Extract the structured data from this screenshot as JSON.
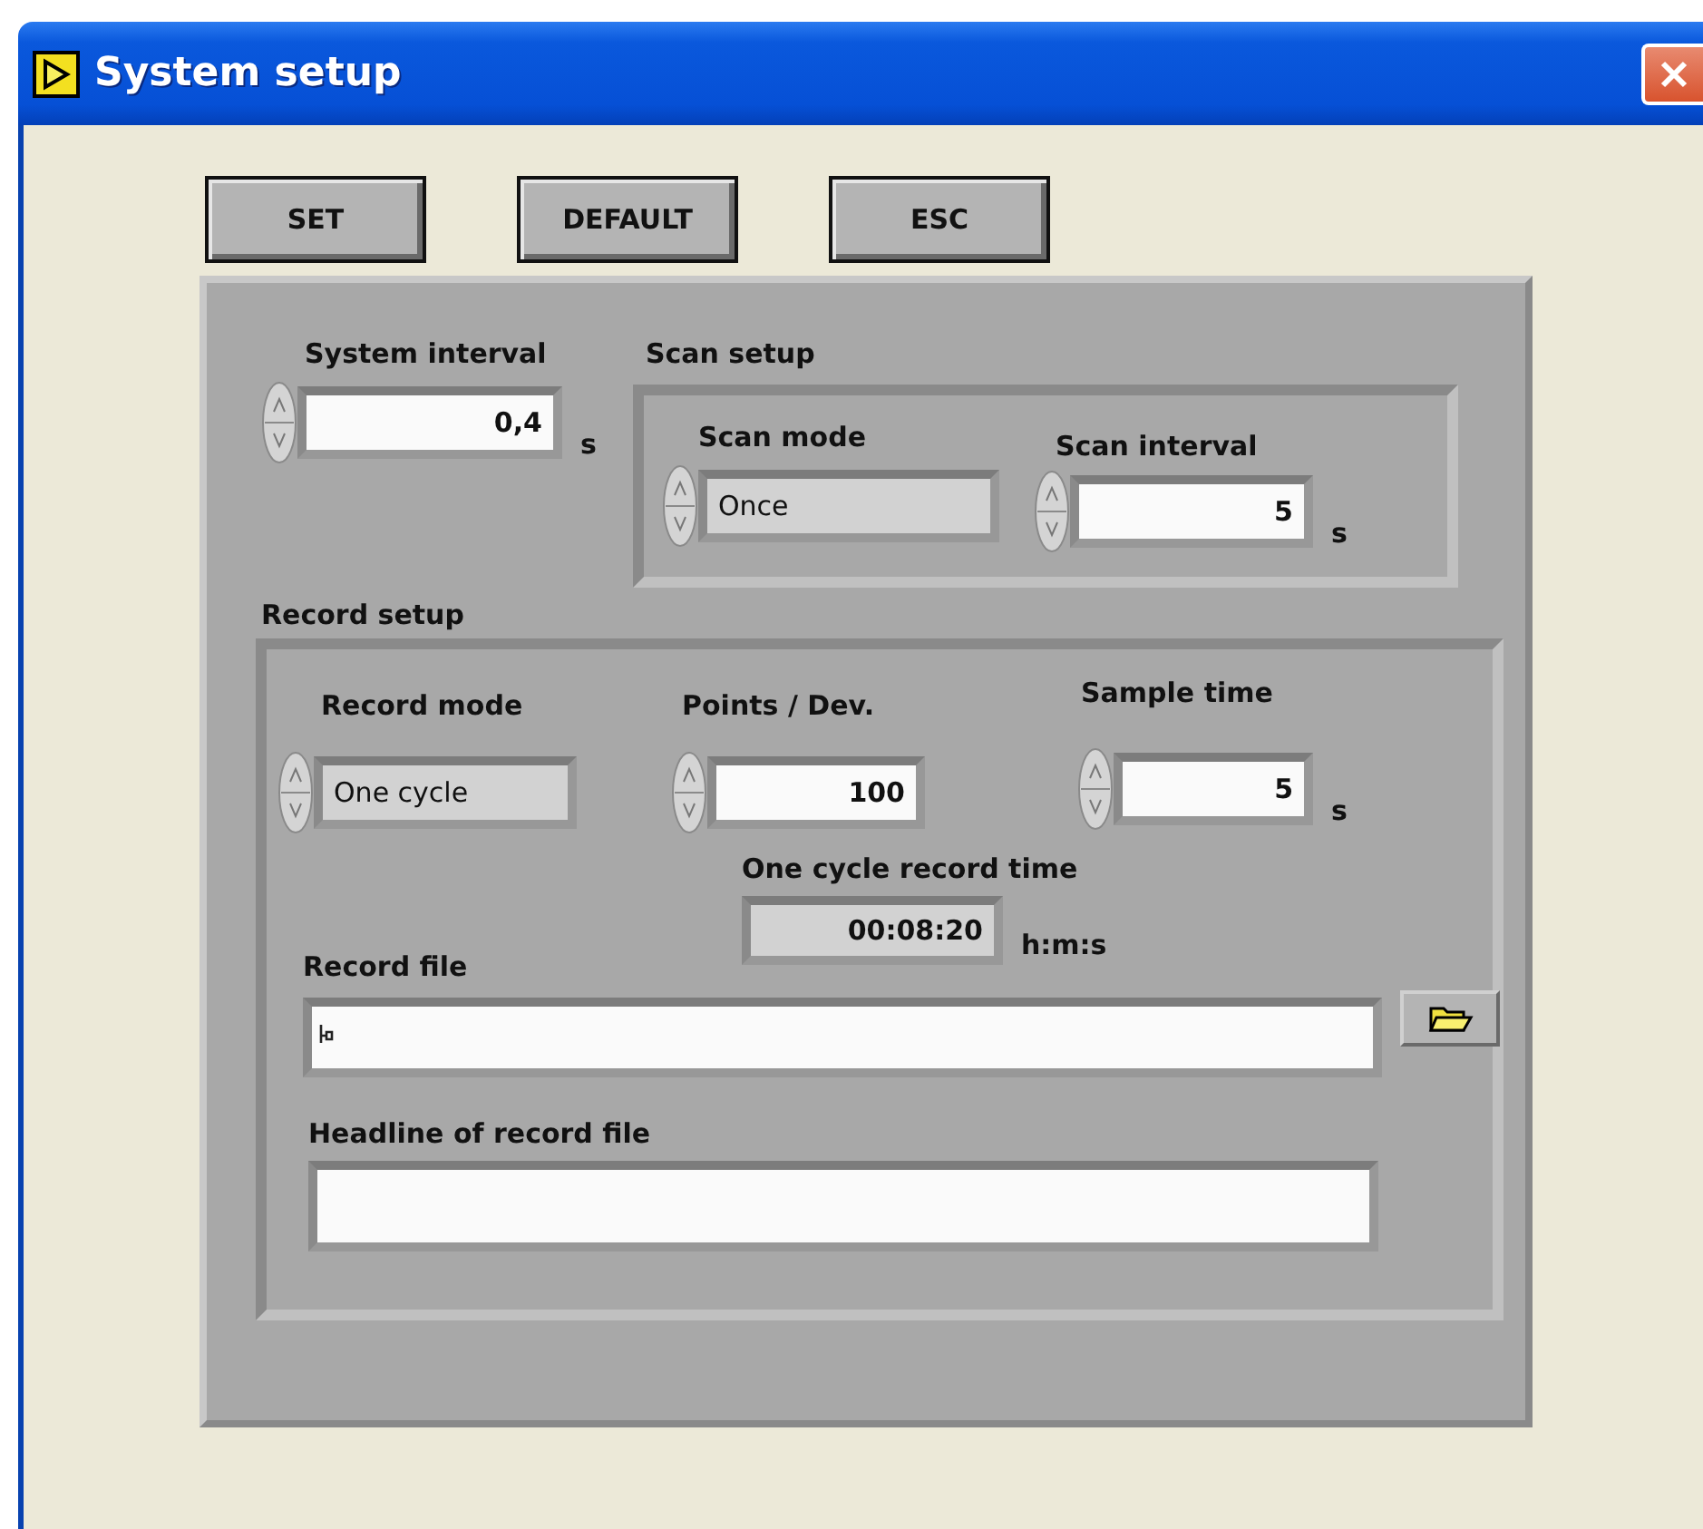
{
  "window": {
    "title": "System setup"
  },
  "buttons": [
    "SET",
    "DEFAULT",
    "ESC"
  ],
  "system_interval": {
    "label": "System interval",
    "value": "0,4",
    "unit": "s"
  },
  "scan_setup": {
    "title": "Scan setup",
    "scan_mode": {
      "label": "Scan mode",
      "value": "Once"
    },
    "scan_interval": {
      "label": "Scan interval",
      "value": "5",
      "unit": "s"
    }
  },
  "record_setup": {
    "title": "Record setup",
    "record_mode": {
      "label": "Record mode",
      "value": "One cycle"
    },
    "points_per_dev": {
      "label": "Points / Dev.",
      "value": "100"
    },
    "sample_time": {
      "label": "Sample time",
      "value": "5",
      "unit": "s"
    },
    "cycle_time": {
      "label": "One cycle record time",
      "value": "00:08:20",
      "unit": "h:m:s"
    },
    "record_file": {
      "label": "Record file"
    },
    "headline": {
      "label": "Headline of record file"
    }
  }
}
